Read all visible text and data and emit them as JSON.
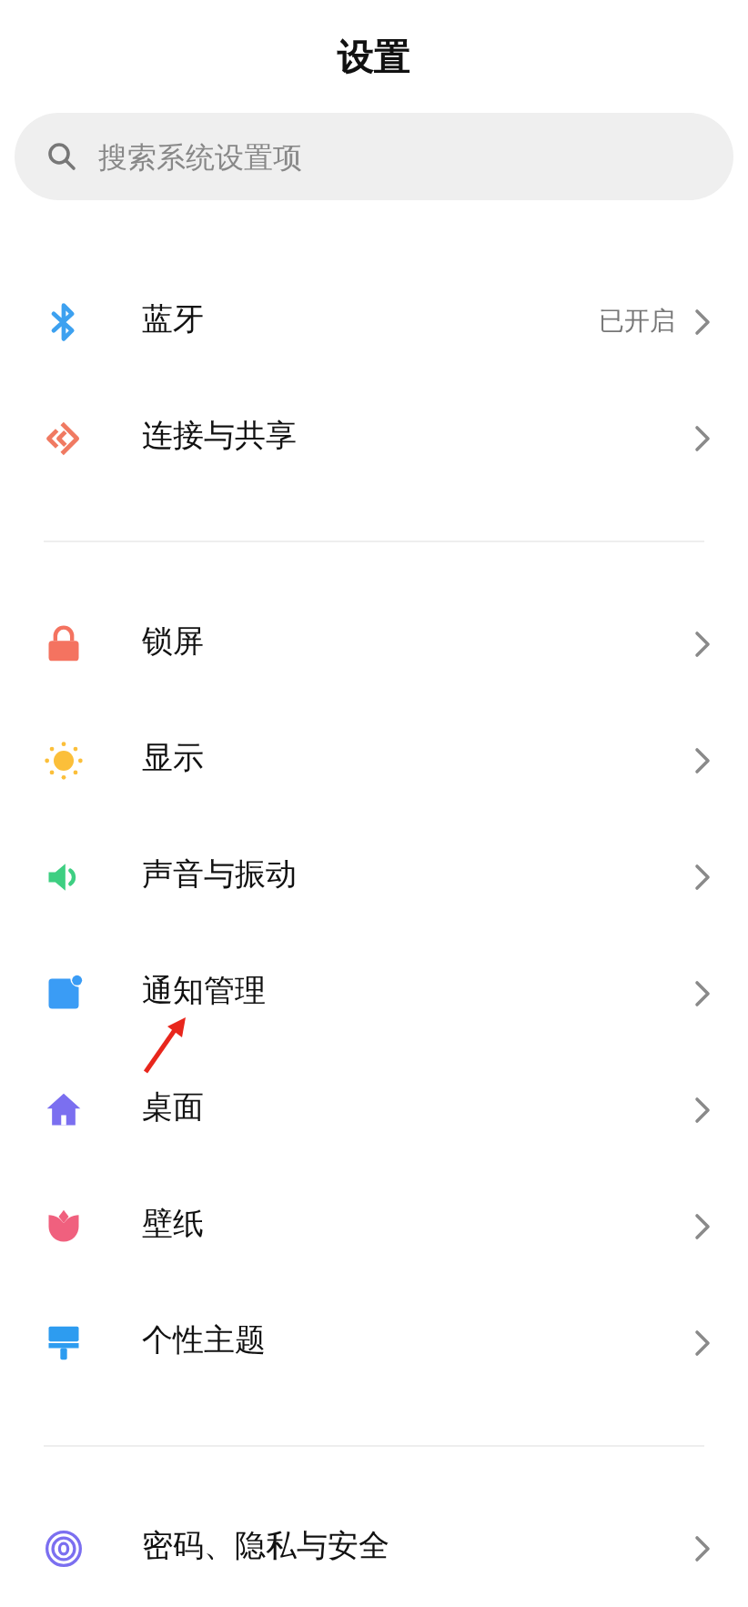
{
  "title": "设置",
  "search": {
    "placeholder": "搜索系统设置项"
  },
  "groups": [
    {
      "items": [
        {
          "kind": "bluetooth",
          "label": "蓝牙",
          "value": "已开启"
        },
        {
          "kind": "share",
          "label": "连接与共享"
        }
      ]
    },
    {
      "items": [
        {
          "kind": "lock",
          "label": "锁屏"
        },
        {
          "kind": "sun",
          "label": "显示"
        },
        {
          "kind": "speaker",
          "label": "声音与振动"
        },
        {
          "kind": "notification",
          "label": "通知管理",
          "annotated": true
        },
        {
          "kind": "home",
          "label": "桌面"
        },
        {
          "kind": "tulip",
          "label": "壁纸"
        },
        {
          "kind": "brush",
          "label": "个性主题"
        }
      ]
    },
    {
      "items": [
        {
          "kind": "fingerprint",
          "label": "密码、隐私与安全"
        }
      ]
    }
  ]
}
